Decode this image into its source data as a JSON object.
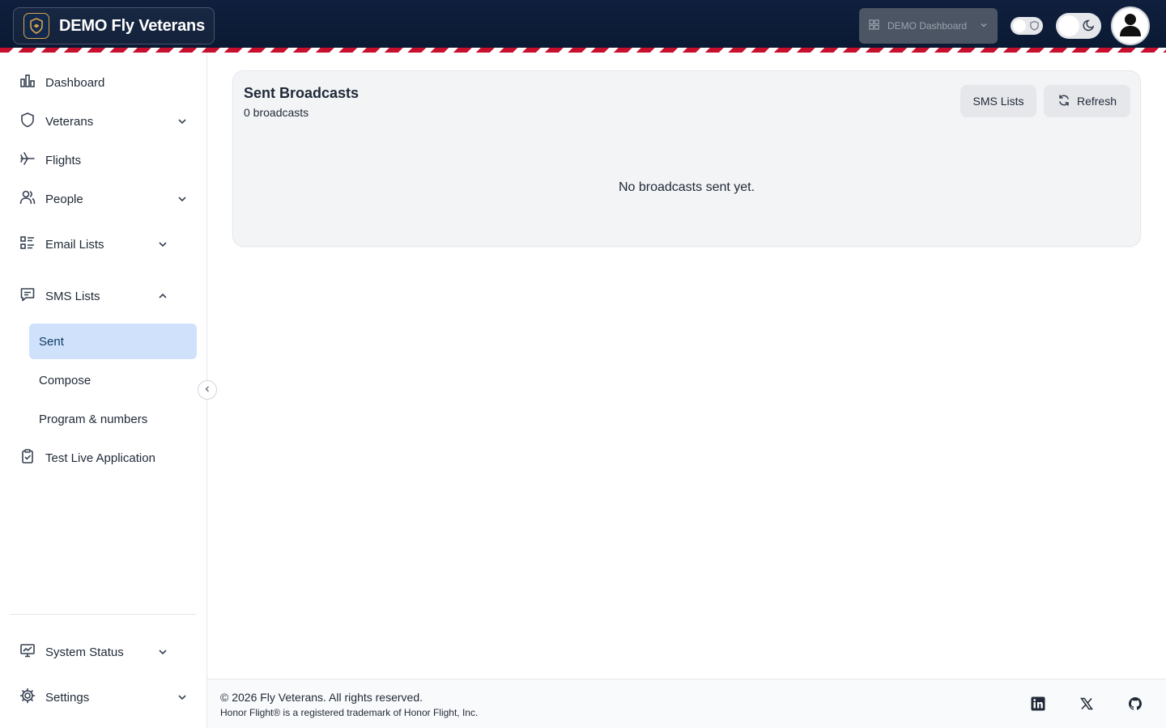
{
  "header": {
    "brand_title": "DEMO Fly Veterans",
    "dashboard_select": "DEMO Dashboard"
  },
  "sidebar": {
    "items": [
      {
        "label": "Dashboard",
        "icon": "bar-chart-icon"
      },
      {
        "label": "Veterans",
        "icon": "shield-icon",
        "expanded": false
      },
      {
        "label": "Flights",
        "icon": "plane-icon"
      },
      {
        "label": "People",
        "icon": "users-icon",
        "expanded": false
      },
      {
        "label": "Email Lists",
        "icon": "list-icon",
        "expanded": false
      },
      {
        "label": "SMS Lists",
        "icon": "message-icon",
        "expanded": true
      },
      {
        "label": "Test Live Application",
        "icon": "clipboard-check-icon"
      }
    ],
    "sms_sub_items": [
      {
        "label": "Sent",
        "active": true
      },
      {
        "label": "Compose",
        "active": false
      },
      {
        "label": "Program & numbers",
        "active": false
      }
    ],
    "bottom_items": [
      {
        "label": "System Status",
        "icon": "monitor-icon",
        "expanded": false
      },
      {
        "label": "Settings",
        "icon": "gear-icon",
        "expanded": false
      }
    ]
  },
  "main": {
    "title": "Sent Broadcasts",
    "count_text": "0 broadcasts",
    "sms_lists_button": "SMS Lists",
    "refresh_button": "Refresh",
    "empty_message": "No broadcasts sent yet."
  },
  "footer": {
    "copyright": "© 2026 Fly Veterans. All rights reserved.",
    "trademark": "Honor Flight® is a registered trademark of Honor Flight, Inc.",
    "social_icons": [
      "linkedin-icon",
      "x-icon",
      "github-icon"
    ]
  },
  "colors": {
    "header_bg": "#0f1f3d",
    "stripe_red": "#c8102e",
    "active_nav_bg": "#cfe1fb"
  }
}
